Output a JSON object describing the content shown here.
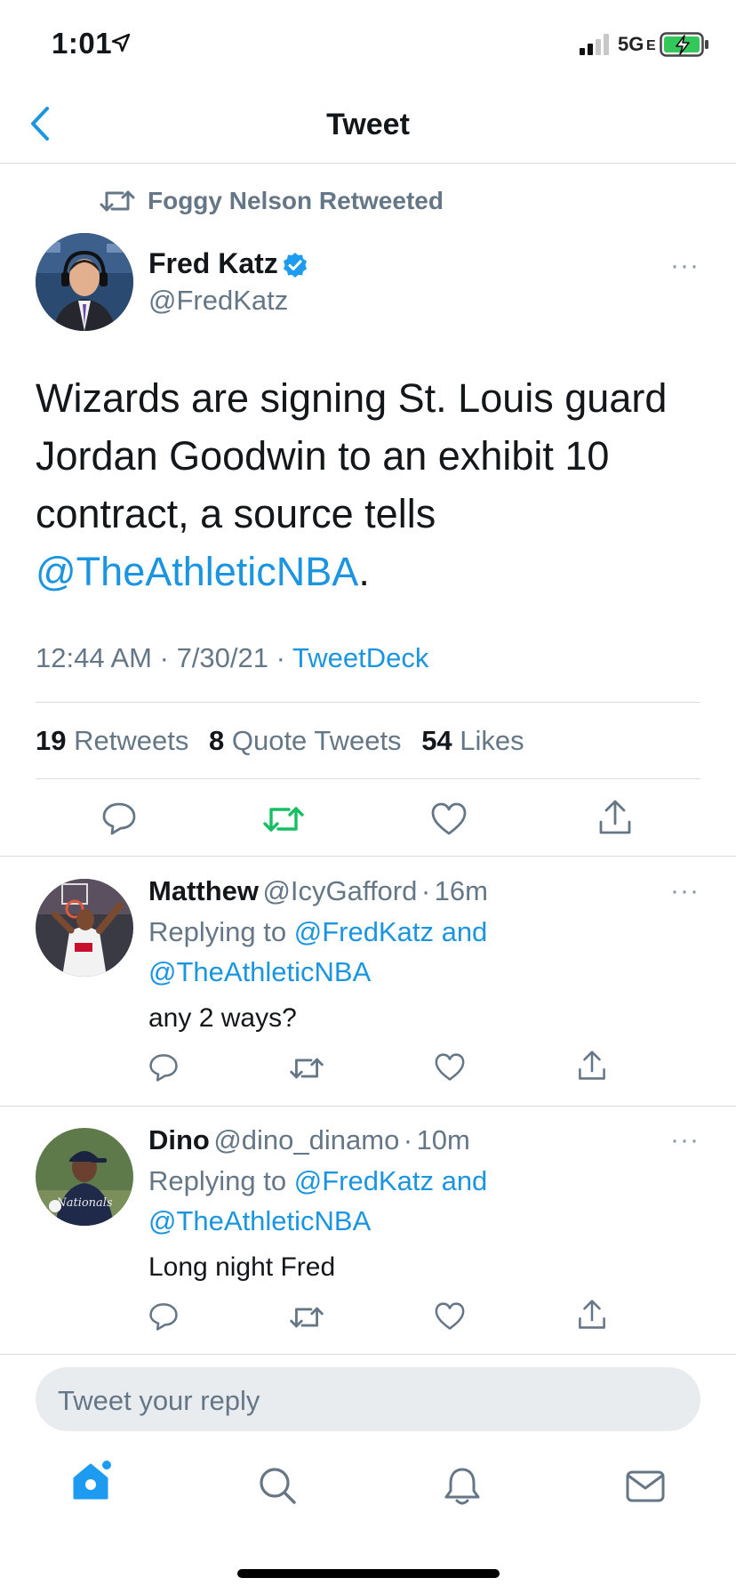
{
  "status_bar": {
    "time": "1:01",
    "network": "5G",
    "network_sub": "E"
  },
  "nav": {
    "title": "Tweet"
  },
  "retweet_header": {
    "label": "Foggy Nelson Retweeted"
  },
  "main_tweet": {
    "name": "Fred Katz",
    "handle": "@FredKatz",
    "text_lines": [
      "Wizards are signing St. Louis guard",
      "Jordan Goodwin to an exhibit 10",
      "contract, a source tells"
    ],
    "mention": "@TheAthleticNBA",
    "mention_suffix": ".",
    "time": "12:44 AM",
    "date": "7/30/21",
    "source": "TweetDeck",
    "sep": "·"
  },
  "stats": {
    "retweets_count": "19",
    "retweets_label": "Retweets",
    "quotes_count": "8",
    "quotes_label": "Quote Tweets",
    "likes_count": "54",
    "likes_label": "Likes"
  },
  "replies": [
    {
      "name": "Matthew",
      "handle": "@IcyGafford",
      "sep": "·",
      "time": "16m",
      "replying_prefix": "Replying to",
      "replying_users": "@FredKatz and",
      "replying_users2": "@TheAthleticNBA",
      "text": "any 2 ways?"
    },
    {
      "name": "Dino",
      "handle": "@dino_dinamo",
      "sep": "·",
      "time": "10m",
      "replying_prefix": "Replying to",
      "replying_users": "@FredKatz and",
      "replying_users2": "@TheAthleticNBA",
      "text": "Long night Fred"
    }
  ],
  "reply_box": {
    "placeholder": "Tweet your reply"
  },
  "more_glyph": "···",
  "colors": {
    "link": "#1b95e0",
    "retweet_active": "#17bf63",
    "muted": "#657786",
    "divider": "#d9dde1"
  },
  "icons": [
    "location-arrow-icon",
    "signal-icon",
    "battery-charging-icon",
    "back-chevron-icon",
    "retweet-icon",
    "verified-badge-icon",
    "reply-icon",
    "like-icon",
    "share-icon",
    "home-icon",
    "search-icon",
    "notifications-icon",
    "messages-icon"
  ]
}
